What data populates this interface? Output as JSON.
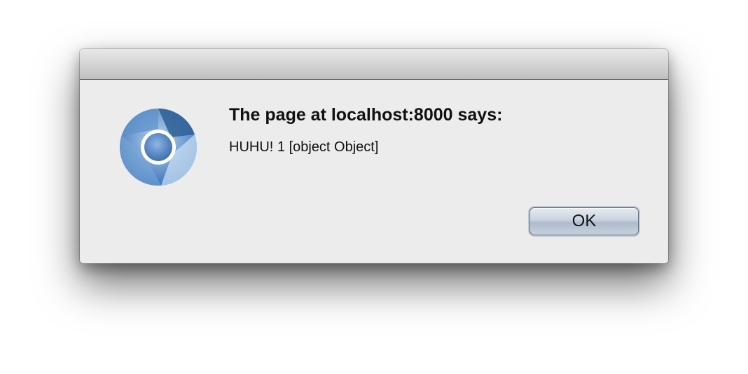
{
  "dialog": {
    "title": "The page at localhost:8000 says:",
    "message": "HUHU! 1 [object Object]",
    "ok_label": "OK",
    "icon": "chromium-logo-icon"
  },
  "colors": {
    "dialog_background": "#ececec",
    "button_accent": "#aebbcb",
    "icon_blue": "#4f84c3"
  }
}
